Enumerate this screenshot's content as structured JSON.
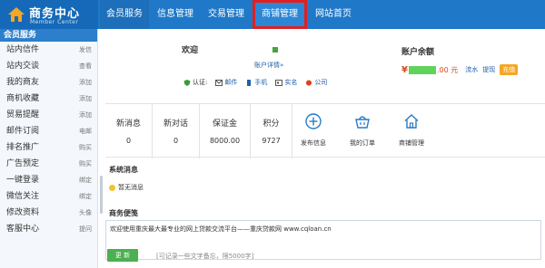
{
  "header": {
    "logo_title": "商务中心",
    "logo_subtitle": "Member Center",
    "nav": [
      {
        "label": "会员服务",
        "state": "active"
      },
      {
        "label": "信息管理",
        "state": ""
      },
      {
        "label": "交易管理",
        "state": ""
      },
      {
        "label": "商铺管理",
        "state": "highlight"
      },
      {
        "label": "网站首页",
        "state": ""
      }
    ]
  },
  "sidebar": {
    "title": "会员服务",
    "items": [
      {
        "label": "站内信件",
        "action": "发信"
      },
      {
        "label": "站内交谈",
        "action": "查看"
      },
      {
        "label": "我的商友",
        "action": "添加"
      },
      {
        "label": "商机收藏",
        "action": "添加"
      },
      {
        "label": "贸易提醒",
        "action": "添加"
      },
      {
        "label": "邮件订阅",
        "action": "电邮"
      },
      {
        "label": "排名推广",
        "action": "购买"
      },
      {
        "label": "广告预定",
        "action": "购买"
      },
      {
        "label": "一键登录",
        "action": "绑定"
      },
      {
        "label": "微信关注",
        "action": "绑定"
      },
      {
        "label": "修改资料",
        "action": "头像"
      },
      {
        "label": "客服中心",
        "action": "提问"
      }
    ]
  },
  "profile": {
    "welcome": "欢迎",
    "account_detail": "账户详情»",
    "auth_label": "认证:",
    "auth_items": [
      {
        "label": "邮件",
        "icon": "mail-icon"
      },
      {
        "label": "手机",
        "icon": "phone-icon"
      },
      {
        "label": "实名",
        "icon": "id-card-icon"
      },
      {
        "label": "公司",
        "icon": "company-icon"
      }
    ]
  },
  "balance": {
    "title": "账户余额",
    "currency": "¥",
    "amount_tail": ".00 元",
    "links": [
      "流水",
      "提现"
    ],
    "recharge": "充值",
    "masked_color": "#5fd35a"
  },
  "stats": [
    {
      "label": "新消息",
      "value": "0"
    },
    {
      "label": "新对话",
      "value": "0"
    },
    {
      "label": "保证金",
      "value": "8000.00"
    },
    {
      "label": "积分",
      "value": "9727"
    }
  ],
  "quick_actions": [
    {
      "label": "发布信息",
      "icon": "plus-circle-icon"
    },
    {
      "label": "我的订单",
      "icon": "basket-icon"
    },
    {
      "label": "商铺管理",
      "icon": "home-icon"
    }
  ],
  "system_messages": {
    "title": "系统消息",
    "empty_text": "暂无消息"
  },
  "memo": {
    "title": "商务便笺",
    "content": "欢迎使用重庆最大最专业的网上贷款交流平台——重庆贷款网 www.cqloan.cn",
    "update_button": "更 新",
    "hint": "[可记录一些文字备忘，限5000字]"
  },
  "colors": {
    "topbar": "#1f78c8",
    "highlight_border": "#e02020",
    "link": "#1e5fa8",
    "accent_orange": "#f5a623",
    "button_green": "#4caf50"
  }
}
